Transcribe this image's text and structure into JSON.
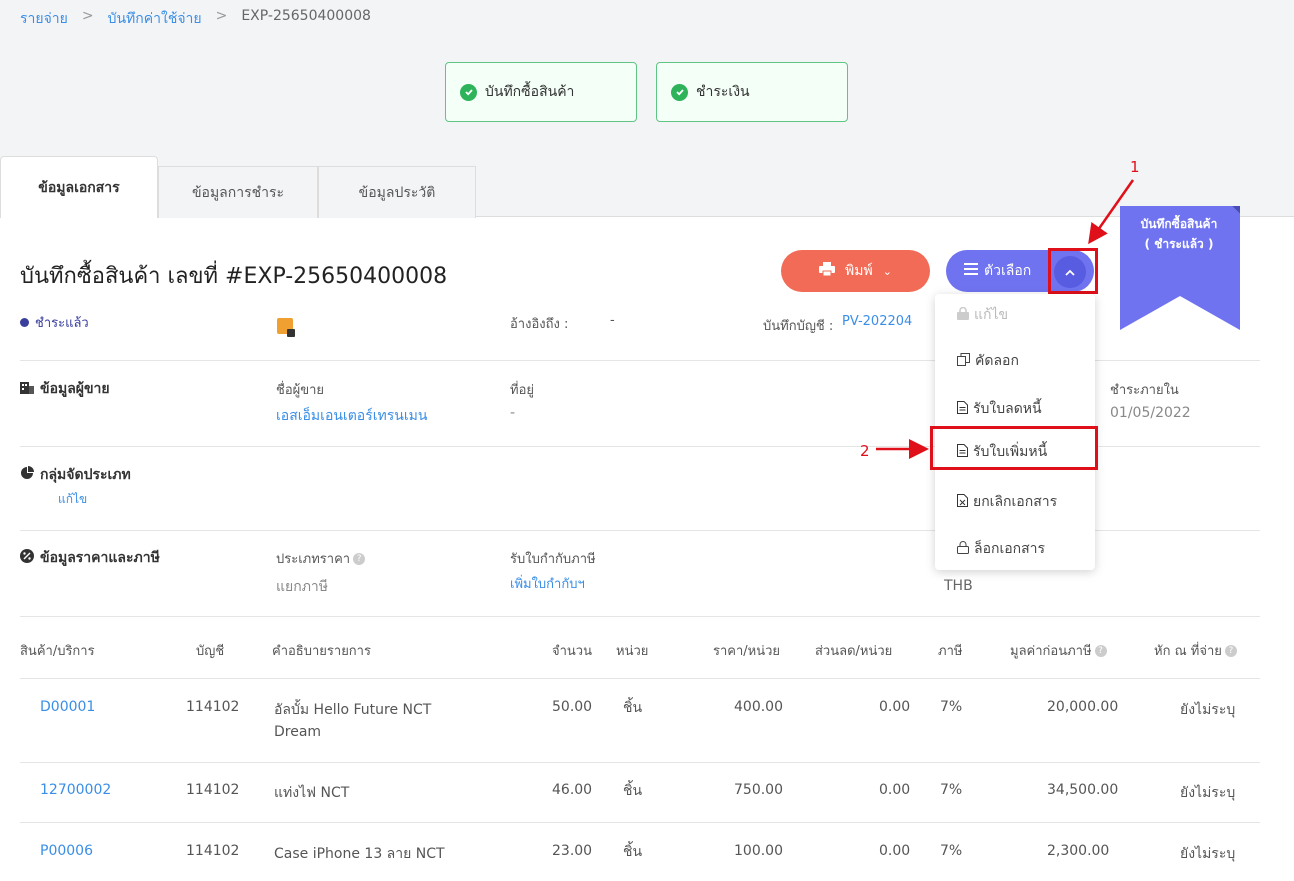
{
  "breadcrumb": {
    "item1": "รายจ่าย",
    "sep1": ">",
    "item2": "บันทึกค่าใช้จ่าย",
    "sep2": ">",
    "item3": "EXP-25650400008"
  },
  "status_steps": {
    "step1": "บันทึกซื้อสินค้า",
    "step2": "ชำระเงิน"
  },
  "tabs": {
    "tab1": "ข้อมูลเอกสาร",
    "tab2": "ข้อมูลการชำระ",
    "tab3": "ข้อมูลประวัติ"
  },
  "header": {
    "title": "บันทึกซื้อสินค้า เลขที่ #EXP-25650400008",
    "print_label": "พิมพ์",
    "options_label": "ตัวเลือก"
  },
  "ribbon": {
    "line1": "บันทึกซื้อสินค้า",
    "line2": "( ชำระแล้ว )"
  },
  "doc_info": {
    "status": "ชำระแล้ว",
    "ref_label": "อ้างอิงถึง :",
    "ref_value": "-",
    "journal_label": "บันทึกบัญชี :",
    "journal_value": "PV-202204"
  },
  "vendor": {
    "section": "ข้อมูลผู้ขาย",
    "name_label": "ชื่อผู้ขาย",
    "name_value": "เอสเอ็มเอนเตอร์เทรนเมน",
    "address_label": "ที่อยู่",
    "address_value": "-",
    "due_label": "ชำระภายใน",
    "due_value": "01/05/2022"
  },
  "category": {
    "section": "กลุ่มจัดประเภท",
    "edit": "แก้ไข"
  },
  "pricing": {
    "section": "ข้อมูลราคาและภาษี",
    "price_type_label": "ประเภทราคา",
    "price_type_value": "แยกภาษี",
    "tax_inv_label": "รับใบกำกับภาษี",
    "tax_inv_value": "เพิ่มใบกำกับฯ",
    "currency": "THB"
  },
  "menu": {
    "edit": "แก้ไข",
    "copy": "คัดลอก",
    "debit_note": "รับใบลดหนี้",
    "credit_note": "รับใบเพิ่มหนี้",
    "cancel": "ยกเลิกเอกสาร",
    "lock": "ล็อกเอกสาร"
  },
  "annotations": {
    "n1": "1",
    "n2": "2"
  },
  "table": {
    "headers": {
      "product": "สินค้า/บริการ",
      "account": "บัญชี",
      "desc": "คำอธิบายรายการ",
      "qty": "จำนวน",
      "unit": "หน่วย",
      "price": "ราคา/หน่วย",
      "discount": "ส่วนลด/หน่วย",
      "tax": "ภาษี",
      "pretax": "มูลค่าก่อนภาษี",
      "wht": "หัก ณ ที่จ่าย"
    },
    "rows": [
      {
        "product": "D00001",
        "account": "114102",
        "desc": "อัลบั้ม Hello Future NCT Dream",
        "qty": "50.00",
        "unit": "ชิ้น",
        "price": "400.00",
        "discount": "0.00",
        "tax": "7%",
        "pretax": "20,000.00",
        "wht": "ยังไม่ระบุ"
      },
      {
        "product": "12700002",
        "account": "114102",
        "desc": "แท่งไฟ NCT",
        "qty": "46.00",
        "unit": "ชิ้น",
        "price": "750.00",
        "discount": "0.00",
        "tax": "7%",
        "pretax": "34,500.00",
        "wht": "ยังไม่ระบุ"
      },
      {
        "product": "P00006",
        "account": "114102",
        "desc": "Case iPhone 13 ลาย NCT",
        "qty": "23.00",
        "unit": "ชิ้น",
        "price": "100.00",
        "discount": "0.00",
        "tax": "7%",
        "pretax": "2,300.00",
        "wht": "ยังไม่ระบุ"
      }
    ]
  },
  "colors": {
    "accent": "#6f73f0",
    "print": "#f26b56",
    "link": "#3a8ee6",
    "success": "#2eb35a",
    "highlight": "#e0101a"
  }
}
